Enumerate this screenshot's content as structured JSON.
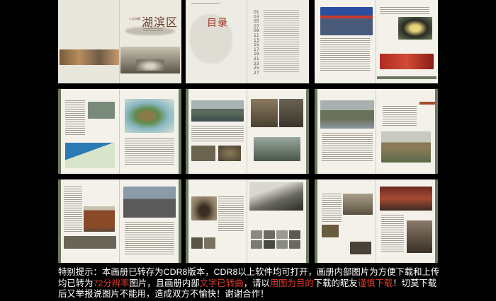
{
  "cover": {
    "title": "湖滨区",
    "subtitle": "人文风情"
  },
  "toc": {
    "heading": "目录",
    "numbers": [
      "01",
      "03",
      "05",
      "07",
      "09",
      "11",
      "13",
      "15",
      "17",
      "19",
      "21",
      "23",
      "25",
      "27"
    ]
  },
  "notice": {
    "prefix": "特别提示：本画册已转存为CDR8版本，CDR8以上软件均可打开，画册内部图片为方便下载和上传均已转为",
    "h1": "72分辨率",
    "mid1": "图片，且画册内部",
    "h2": "文字已转曲",
    "mid2": "，请以",
    "h3": "用图为目的",
    "mid3": "下载的昵友",
    "h4": "谨慎下载",
    "suffix": "！切莫下载后又举报说图片不能用，造成双方不愉快！谢谢合作！"
  },
  "colors": {
    "background": "#000000",
    "paper": "#f3f1ea",
    "accent_red": "#e03a2a",
    "sidebar_green": "#6c7a5e"
  }
}
